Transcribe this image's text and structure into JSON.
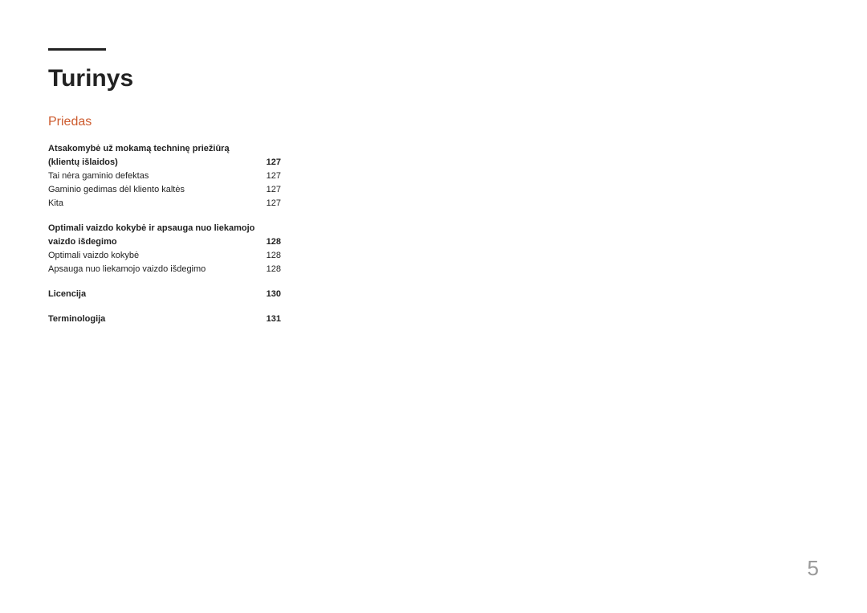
{
  "title": "Turinys",
  "section": "Priedas",
  "page_number": "5",
  "toc": [
    {
      "heading": {
        "label": "Atsakomybė už mokamą techninę priežiūrą (klientų išlaidos)",
        "page": "127"
      },
      "items": [
        {
          "label": "Tai nėra gaminio defektas",
          "page": "127"
        },
        {
          "label": "Gaminio gedimas dėl kliento kaltės",
          "page": "127"
        },
        {
          "label": "Kita",
          "page": "127"
        }
      ]
    },
    {
      "heading": {
        "label": "Optimali vaizdo kokybė ir apsauga nuo liekamojo vaizdo išdegimo",
        "page": "128"
      },
      "items": [
        {
          "label": "Optimali vaizdo kokybė",
          "page": "128"
        },
        {
          "label": "Apsauga nuo liekamojo vaizdo išdegimo",
          "page": "128"
        }
      ]
    },
    {
      "heading": {
        "label": "Licencija",
        "page": "130"
      },
      "items": []
    },
    {
      "heading": {
        "label": "Terminologija",
        "page": "131"
      },
      "items": []
    }
  ]
}
